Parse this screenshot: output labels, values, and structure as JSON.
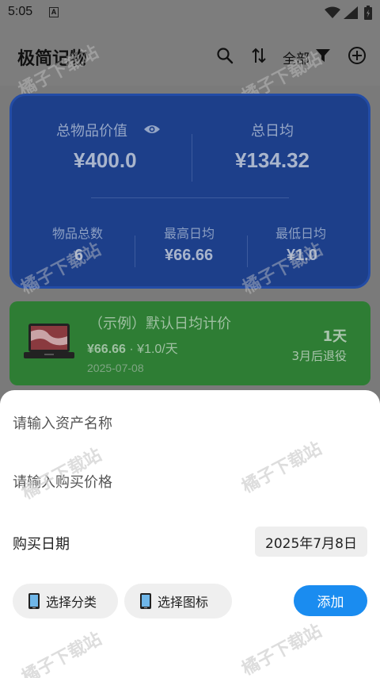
{
  "status_bar": {
    "time": "5:05",
    "notification_icon": "a-icon"
  },
  "app_bar": {
    "title": "极简记物",
    "filter_label": "全部",
    "icons": [
      "search-icon",
      "sort-icon",
      "filter-icon",
      "add-circle-icon"
    ]
  },
  "summary": {
    "total_value_label": "总物品价值",
    "total_value": "¥400.0",
    "daily_avg_label": "总日均",
    "daily_avg": "¥134.32",
    "item_count_label": "物品总数",
    "item_count": "6",
    "max_daily_label": "最高日均",
    "max_daily": "¥66.66",
    "min_daily_label": "最低日均",
    "min_daily": "¥1.0"
  },
  "item": {
    "name": "（示例）默认日均计价",
    "price": "¥66.66",
    "daily_price": "· ¥1.0/天",
    "date": "2025-07-08",
    "days": "1天",
    "retire": "3月后退役"
  },
  "sheet": {
    "name_placeholder": "请输入资产名称",
    "price_placeholder": "请输入购买价格",
    "date_label": "购买日期",
    "date_value": "2025年7月8日",
    "category_button": "选择分类",
    "icon_button": "选择图标",
    "add_button": "添加"
  },
  "watermark": "橘子下载站",
  "colors": {
    "summary_bg": "#1d3f8a",
    "item_bg": "#2e7d34",
    "add_button": "#1a8cf0"
  }
}
